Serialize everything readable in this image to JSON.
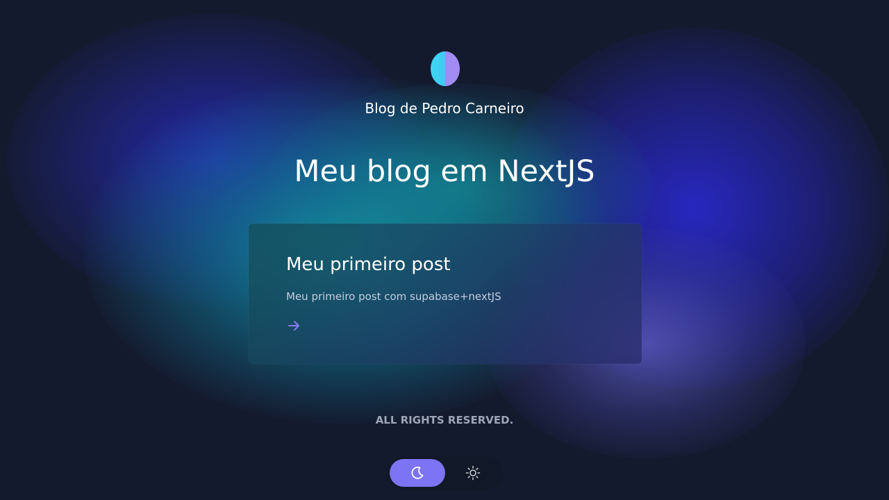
{
  "header": {
    "site_title": "Blog de Pedro Carneiro",
    "avatar_icon": "avatar-logo-icon"
  },
  "main": {
    "page_title": "Meu blog em NextJS",
    "posts": [
      {
        "title": "Meu primeiro post",
        "excerpt": "Meu primeiro post com supabase+nextJS",
        "link_icon": "arrow-right-icon"
      }
    ]
  },
  "footer": {
    "text": "ALL RIGHTS RESERVED."
  },
  "theme_toggle": {
    "selected": "dark",
    "options": [
      {
        "value": "dark",
        "icon": "moon-icon"
      },
      {
        "value": "light",
        "icon": "sun-icon"
      }
    ]
  },
  "colors": {
    "accent": "#7c74f2",
    "link_arrow": "#8b7cf6",
    "background": "#141a2e"
  }
}
